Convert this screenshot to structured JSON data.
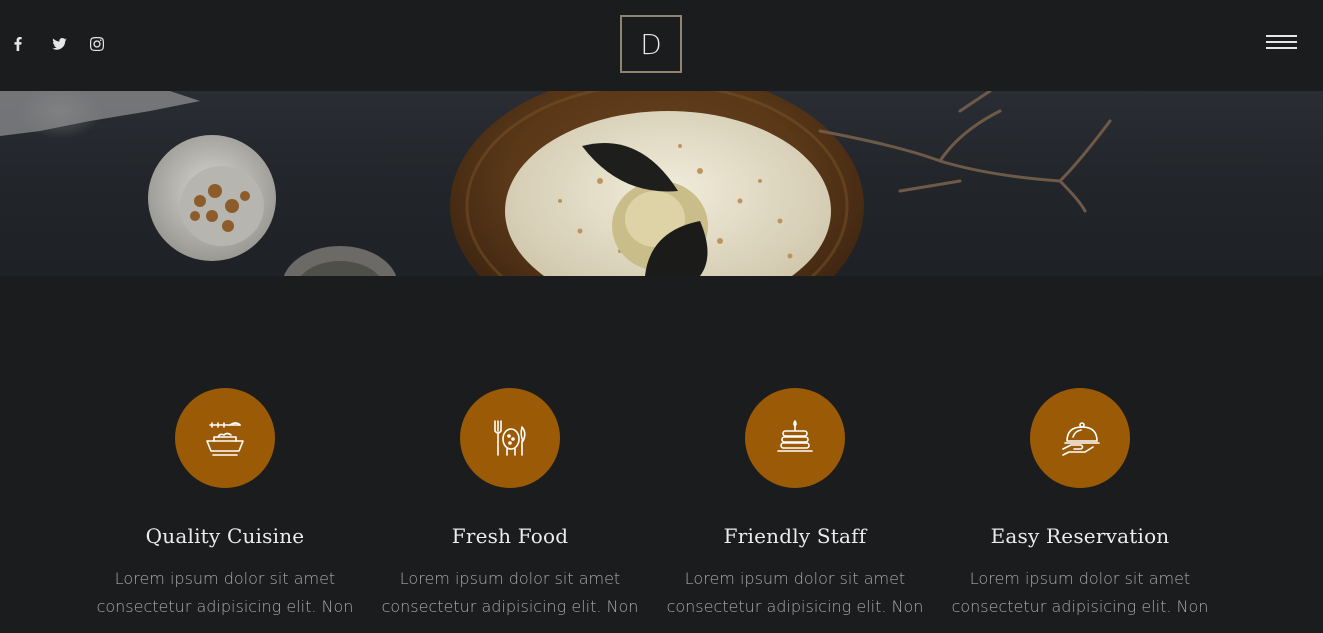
{
  "header": {
    "logo_letter": "D",
    "social": [
      {
        "icon": "facebook-icon"
      },
      {
        "icon": "twitter-icon"
      },
      {
        "icon": "instagram-icon"
      }
    ],
    "menu_icon": "hamburger-menu-icon"
  },
  "colors": {
    "background": "#1b1c1e",
    "accent": "#9b5a06",
    "logo_border": "#8e8470"
  },
  "features": [
    {
      "icon": "cuisine-bowl-icon",
      "title": "Quality Cuisine",
      "text": "Lorem ipsum dolor sit amet consectetur adipisicing elit. Non"
    },
    {
      "icon": "fresh-food-icon",
      "title": "Fresh Food",
      "text": "Lorem ipsum dolor sit amet consectetur adipisicing elit. Non"
    },
    {
      "icon": "pancakes-icon",
      "title": "Friendly Staff",
      "text": "Lorem ipsum dolor sit amet consectetur adipisicing elit. Non"
    },
    {
      "icon": "serving-cloche-icon",
      "title": "Easy Reservation",
      "text": "Lorem ipsum dolor sit amet consectetur adipisicing elit. Non"
    }
  ]
}
